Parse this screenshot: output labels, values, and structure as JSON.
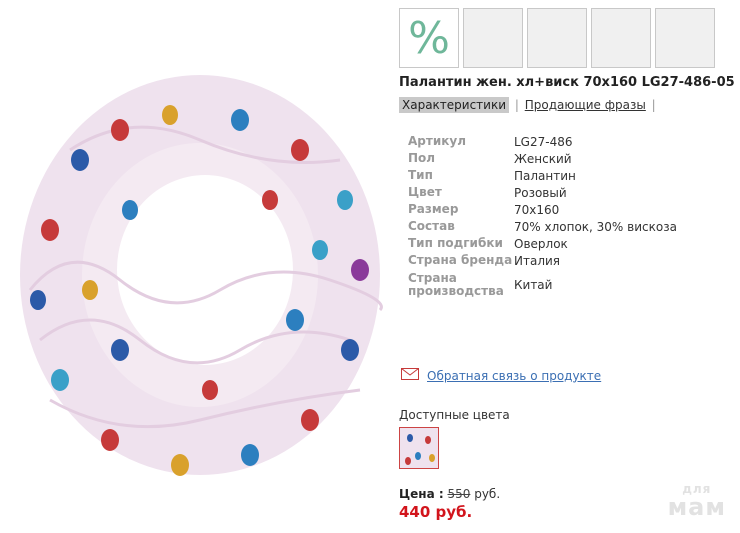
{
  "product": {
    "title": "Палантин жен. хл+виск 70х160 LG27-486-05",
    "sale_symbol": "%"
  },
  "tabs": {
    "characteristics": "Характеристики",
    "selling_phrases": "Продающие фразы"
  },
  "specs": [
    {
      "key": "Артикул",
      "value": "LG27-486"
    },
    {
      "key": "Пол",
      "value": "Женский"
    },
    {
      "key": "Тип",
      "value": "Палантин"
    },
    {
      "key": "Цвет",
      "value": "Розовый"
    },
    {
      "key": "Размер",
      "value": "70x160"
    },
    {
      "key": "Состав",
      "value": "70% хлопок, 30% вискоза"
    },
    {
      "key": "Тип подгибки",
      "value": "Оверлок"
    },
    {
      "key": "Страна бренда",
      "value": "Италия"
    },
    {
      "key": "Страна производства",
      "value": "Китай"
    }
  ],
  "feedback": {
    "label": "Обратная связь о продукте"
  },
  "colors": {
    "title": "Доступные цвета"
  },
  "price": {
    "label": "Цена :",
    "old": "550",
    "currency": "руб.",
    "new": "440 руб."
  },
  "watermark": {
    "top": "для",
    "bottom": "мам"
  },
  "accent_colors": {
    "sale": "#d2141c",
    "link": "#3b6fb3",
    "percent": "#6fb79a"
  }
}
